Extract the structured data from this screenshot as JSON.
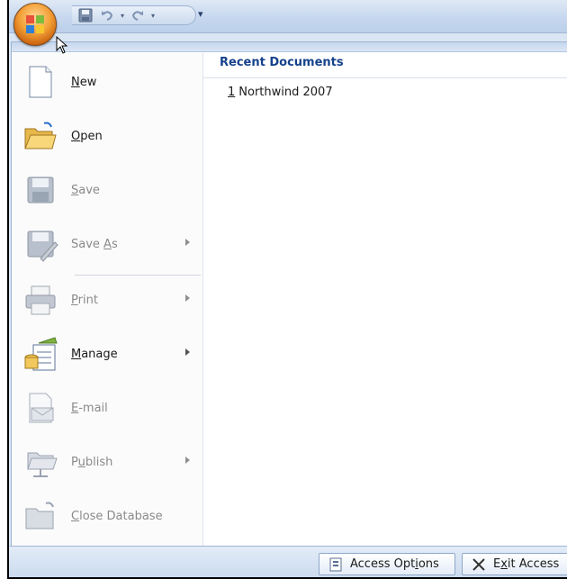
{
  "quick_access": {
    "save_icon": "save-icon",
    "undo_icon": "undo-icon",
    "redo_icon": "redo-icon",
    "customize_glyph": "▾"
  },
  "menu": {
    "items": [
      {
        "label_pre": "",
        "label_key": "N",
        "label_post": "ew",
        "icon": "new-document-icon",
        "enabled": true,
        "submenu": false
      },
      {
        "label_pre": "",
        "label_key": "O",
        "label_post": "pen",
        "icon": "open-folder-icon",
        "enabled": true,
        "submenu": false
      },
      {
        "label_pre": "",
        "label_key": "S",
        "label_post": "ave",
        "icon": "save-icon",
        "enabled": false,
        "submenu": false
      },
      {
        "label_pre": "Save ",
        "label_key": "A",
        "label_post": "s",
        "icon": "save-as-icon",
        "enabled": false,
        "submenu": true
      },
      {
        "label_pre": "",
        "label_key": "P",
        "label_post": "rint",
        "icon": "printer-icon",
        "enabled": false,
        "submenu": true
      },
      {
        "label_pre": "",
        "label_key": "M",
        "label_post": "anage",
        "icon": "manage-database-icon",
        "enabled": true,
        "submenu": true
      },
      {
        "label_pre": "",
        "label_key": "E",
        "label_post": "-mail",
        "icon": "email-icon",
        "enabled": false,
        "submenu": false
      },
      {
        "label_pre": "P",
        "label_key": "u",
        "label_post": "blish",
        "icon": "publish-icon",
        "enabled": false,
        "submenu": true
      },
      {
        "label_pre": "",
        "label_key": "C",
        "label_post": "lose Database",
        "icon": "close-database-icon",
        "enabled": false,
        "submenu": false
      }
    ]
  },
  "recent": {
    "header": "Recent Documents",
    "documents": [
      {
        "number": "1",
        "name": "Northwind 2007"
      }
    ]
  },
  "bottom": {
    "options_pre": "Access Opt",
    "options_key": "i",
    "options_post": "ons",
    "exit_pre": "E",
    "exit_key": "x",
    "exit_post": "it Access"
  }
}
